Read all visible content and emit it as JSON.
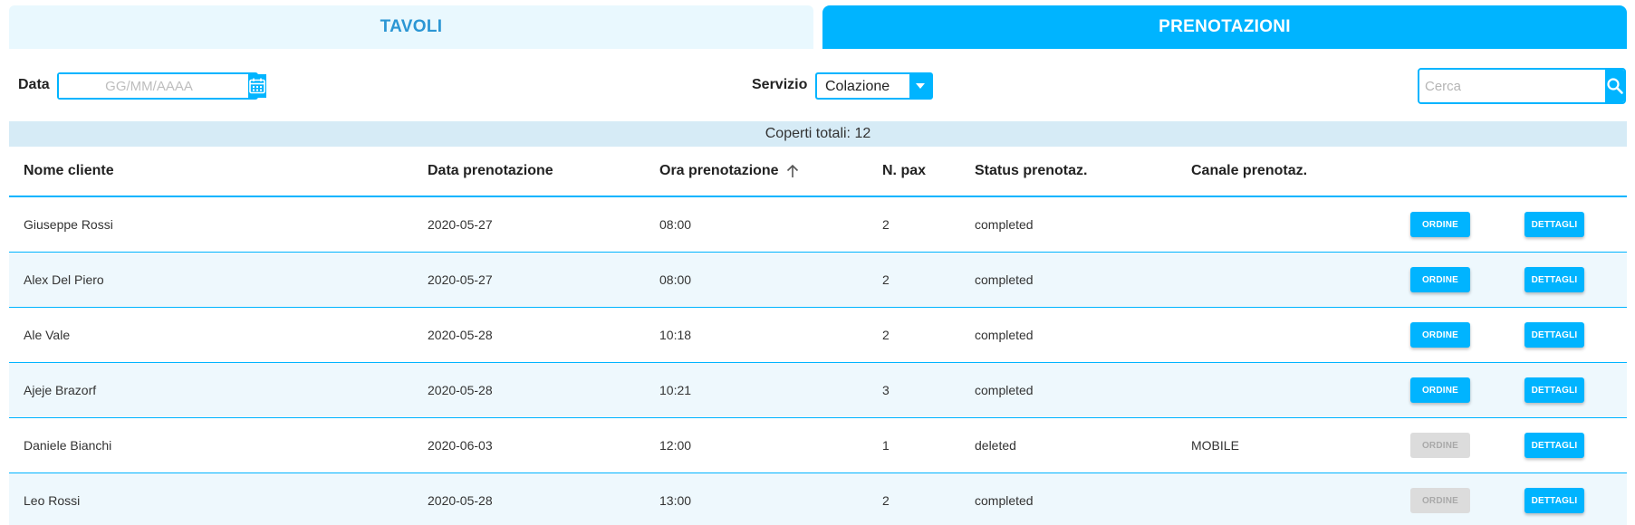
{
  "tabs": [
    {
      "label": "TAVOLI",
      "active": false
    },
    {
      "label": "PRENOTAZIONI",
      "active": true
    }
  ],
  "filters": {
    "date_label": "Data",
    "date_placeholder": "GG/MM/AAAA",
    "service_label": "Servizio",
    "service_value": "Colazione",
    "search_placeholder": "Cerca"
  },
  "summary": {
    "text": "Coperti totali: 12"
  },
  "table": {
    "columns": [
      "Nome cliente",
      "Data prenotazione",
      "Ora prenotazione",
      "N. pax",
      "Status prenotaz.",
      "Canale prenotaz."
    ],
    "sort_icon": "arrow-up-icon",
    "rows": [
      {
        "name": "Giuseppe Rossi",
        "date": "2020-05-27",
        "time": "08:00",
        "pax": "2",
        "status": "completed",
        "channel": "",
        "order_label": "ORDINE",
        "order_enabled": true,
        "details_label": "DETTAGLI"
      },
      {
        "name": "Alex Del Piero",
        "date": "2020-05-27",
        "time": "08:00",
        "pax": "2",
        "status": "completed",
        "channel": "",
        "order_label": "ORDINE",
        "order_enabled": true,
        "details_label": "DETTAGLI"
      },
      {
        "name": "Ale Vale",
        "date": "2020-05-28",
        "time": "10:18",
        "pax": "2",
        "status": "completed",
        "channel": "",
        "order_label": "ORDINE",
        "order_enabled": true,
        "details_label": "DETTAGLI"
      },
      {
        "name": "Ajeje Brazorf",
        "date": "2020-05-28",
        "time": "10:21",
        "pax": "3",
        "status": "completed",
        "channel": "",
        "order_label": "ORDINE",
        "order_enabled": true,
        "details_label": "DETTAGLI"
      },
      {
        "name": "Daniele Bianchi",
        "date": "2020-06-03",
        "time": "12:00",
        "pax": "1",
        "status": "deleted",
        "channel": "MOBILE",
        "order_label": "ORDINE",
        "order_enabled": false,
        "details_label": "DETTAGLI"
      },
      {
        "name": "Leo Rossi",
        "date": "2020-05-28",
        "time": "13:00",
        "pax": "2",
        "status": "completed",
        "channel": "",
        "order_label": "ORDINE",
        "order_enabled": false,
        "details_label": "DETTAGLI"
      }
    ]
  },
  "colors": {
    "accent": "#00b4ff",
    "tab_inactive_bg": "#e9f8fe",
    "tab_inactive_text": "#2b96d4",
    "summary_bg": "#d6ebf6",
    "row_alt_bg": "#eef8fd",
    "disabled_bg": "#dcdcdc"
  }
}
